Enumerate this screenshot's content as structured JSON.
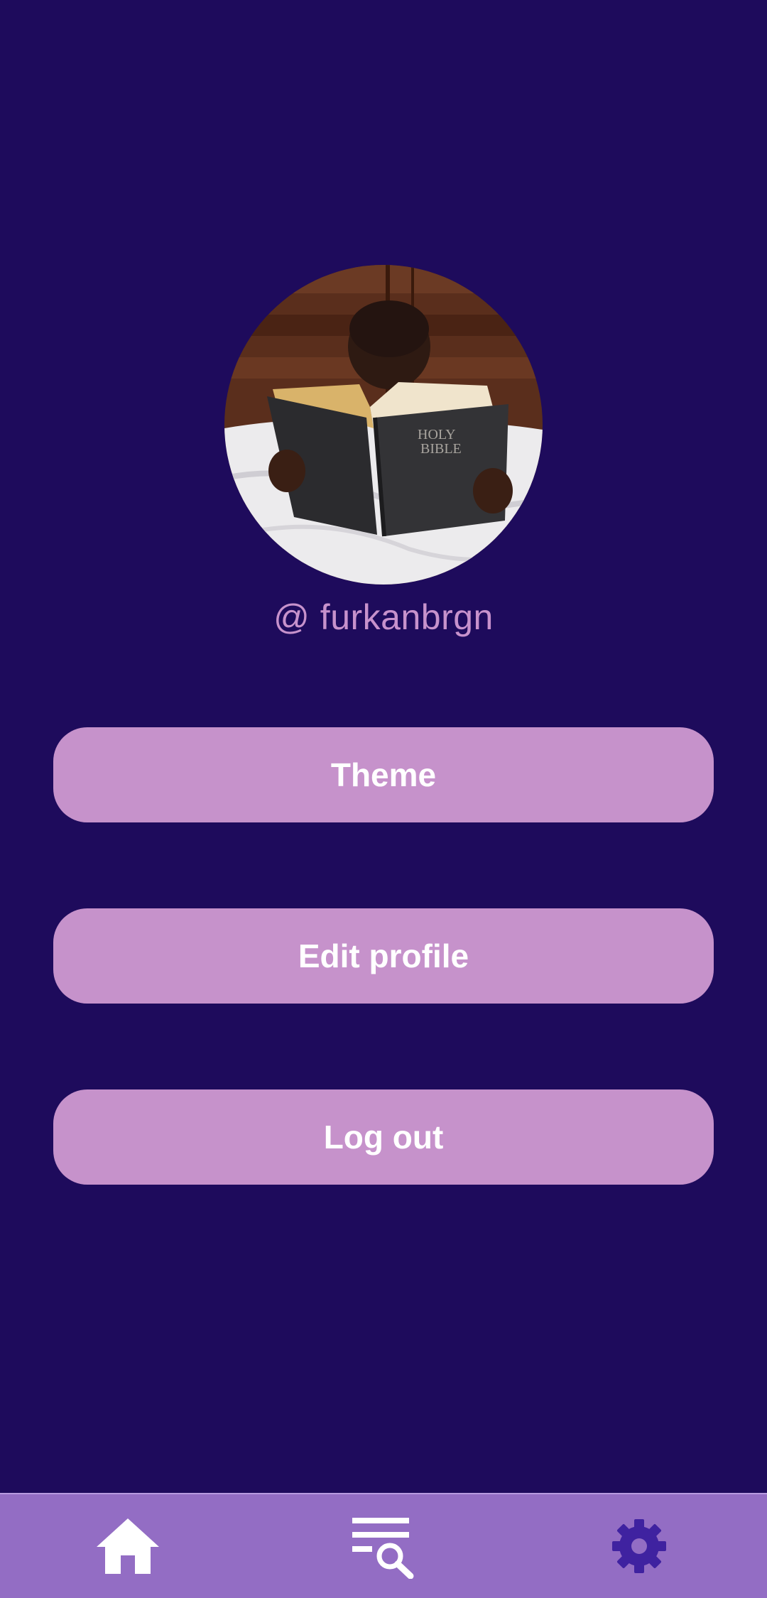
{
  "profile": {
    "username": "@ furkanbrgn",
    "avatar_image": "child reading a book with a dark cover on a bed",
    "avatar_cover_text": "HOLY BIBLE"
  },
  "buttons": {
    "theme": "Theme",
    "edit_profile": "Edit profile",
    "log_out": "Log out"
  },
  "bottom_nav": {
    "items": [
      {
        "icon": "home-icon",
        "active": true
      },
      {
        "icon": "search-list-icon",
        "active": false
      },
      {
        "icon": "gear-icon",
        "active": false
      }
    ]
  },
  "colors": {
    "background": "#1e0b5c",
    "button": "#c692cb",
    "username_text": "#c792cc",
    "nav_bar": "#936dc4",
    "nav_active_icon": "#ffffff",
    "nav_inactive_icon": "#ffffff",
    "nav_settings_icon": "#3f22a0"
  }
}
